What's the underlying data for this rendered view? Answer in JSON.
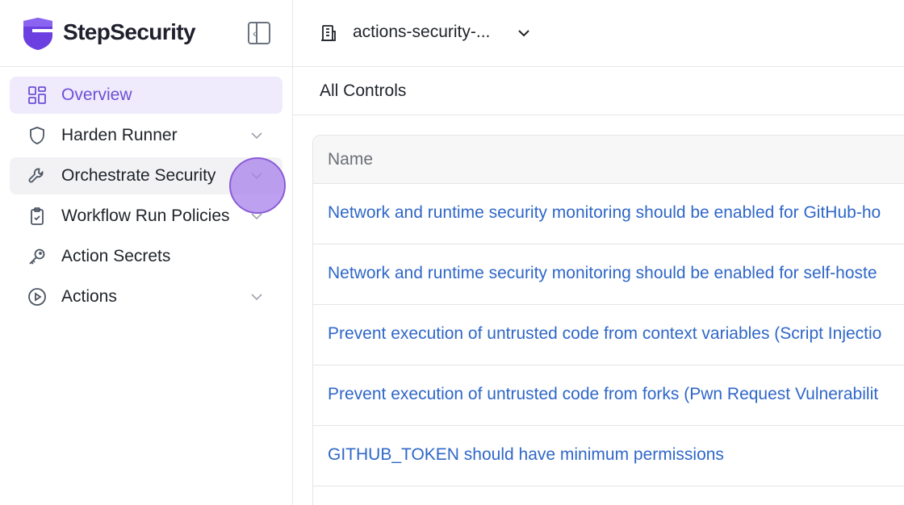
{
  "brand": {
    "name": "StepSecurity"
  },
  "sidebar": {
    "items": [
      {
        "label": "Overview",
        "icon": "grid-icon",
        "active": true,
        "has_chevron": false
      },
      {
        "label": "Harden Runner",
        "icon": "shield-icon",
        "active": false,
        "has_chevron": true
      },
      {
        "label": "Orchestrate Security",
        "icon": "wrench-icon",
        "active": false,
        "has_chevron": true
      },
      {
        "label": "Workflow Run Policies",
        "icon": "clipboard-check-icon",
        "active": false,
        "has_chevron": true
      },
      {
        "label": "Action Secrets",
        "icon": "key-icon",
        "active": false,
        "has_chevron": false
      },
      {
        "label": "Actions",
        "icon": "play-circle-icon",
        "active": false,
        "has_chevron": true
      }
    ]
  },
  "topbar": {
    "org_name": "actions-security-..."
  },
  "controls": {
    "title": "All Controls",
    "table": {
      "header_name": "Name",
      "rows": [
        "Network and runtime security monitoring should be enabled for GitHub-ho",
        "Network and runtime security monitoring should be enabled for self-hoste",
        "Prevent execution of untrusted code from context variables (Script Injectio",
        "Prevent execution of untrusted code from forks (Pwn Request Vulnerabilit",
        "GITHUB_TOKEN should have minimum permissions"
      ]
    }
  },
  "colors": {
    "accent": "#6d4fd6",
    "link": "#2f67c8",
    "active_bg": "#efebfd"
  }
}
